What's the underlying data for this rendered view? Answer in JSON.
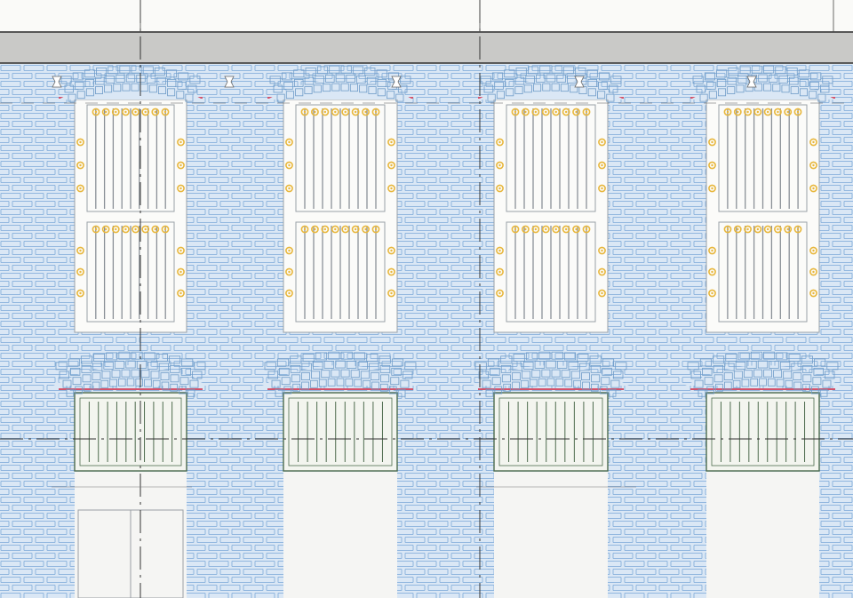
{
  "drawing": {
    "subject": "facade-elevation",
    "bays": 4,
    "upper_windows": {
      "rows_of_panes": 2,
      "bars_per_pane": 9,
      "rosettes_per_rail": 8
    },
    "lower_transoms": {
      "bars": 10
    },
    "colors": {
      "sky": "#fafaf8",
      "cornice": "#c9c9c7",
      "cornice_edge": "#2b2b2b",
      "wall": "#dae7f5",
      "brick_stroke": "#7aa8d8",
      "arch_stroke": "#6f9cc8",
      "lintel_red": "#d4536b",
      "frame": "#fbfbf9",
      "frame_stroke": "#9aa0a6",
      "bar": "#8a9097",
      "rosette": "#e8b73c",
      "transom_stroke": "#4d6b4d",
      "transom_fill": "#f3f5ef",
      "door": "#f5f5f3",
      "axis_line": "#333333"
    }
  }
}
